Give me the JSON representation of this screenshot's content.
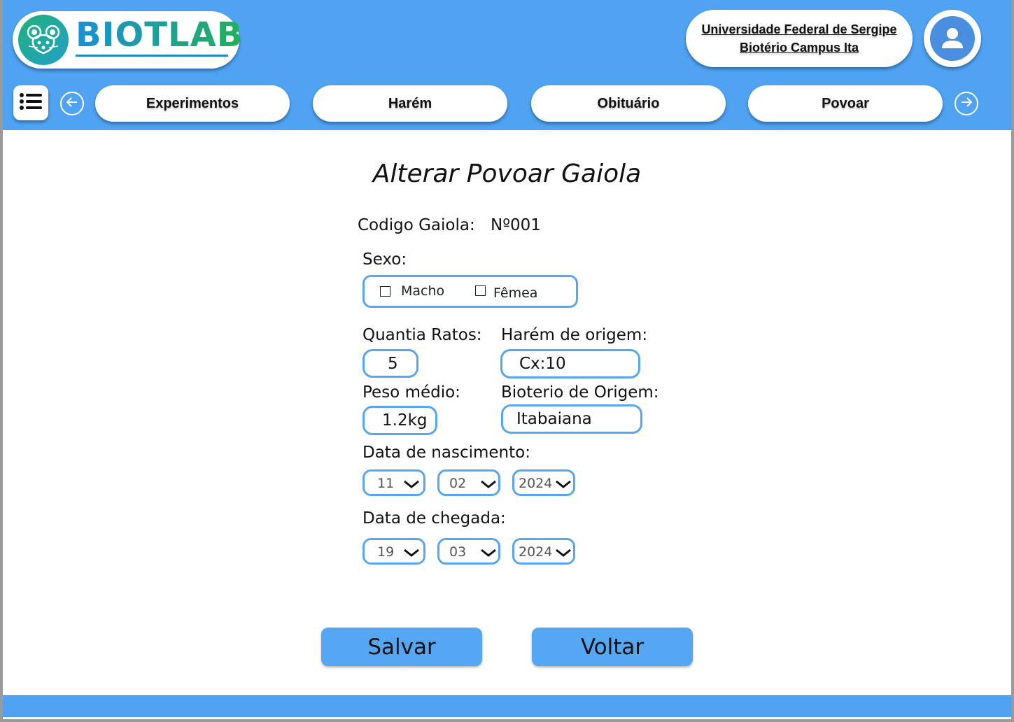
{
  "header": {
    "brand": "BIOTLAB",
    "university_line1": "Universidade Federal de Sergipe",
    "university_line2": "Biotério Campus Ita",
    "nav_tabs": [
      "Experimentos",
      "Harém",
      "Obituário",
      "Povoar"
    ]
  },
  "icons": {
    "logo": "mouse-icon",
    "menu": "list-menu-icon",
    "prev": "arrow-left-icon",
    "next": "arrow-right-icon",
    "avatar": "user-icon",
    "dropdown": "chevron-down-icon"
  },
  "colors": {
    "primary": "#4fa3f2",
    "field_border": "#5aa6ec",
    "button": "#55a7f3",
    "brand_gradient_start": "#1b8fd6",
    "brand_gradient_end": "#22b05a"
  },
  "form": {
    "title": "Alterar Povoar Gaiola",
    "codigo_label": "Codigo Gaiola:",
    "codigo_value": "Nº001",
    "sexo_label": "Sexo:",
    "sexo_options": [
      "Macho",
      "Fêmea"
    ],
    "quantia_label": "Quantia Ratos:",
    "quantia_value": "5",
    "harem_label": "Harém de origem:",
    "harem_value": "Cx:10",
    "peso_label": "Peso médio:",
    "peso_value": "1.2kg",
    "bioterio_label": "Bioterio de Origem:",
    "bioterio_value": "Itabaiana",
    "nascimento_label": "Data de nascimento:",
    "nascimento_day": "11",
    "nascimento_month": "02",
    "nascimento_year": "2024",
    "chegada_label": "Data  de chegada:",
    "chegada_day": "19",
    "chegada_month": "03",
    "chegada_year": "2024"
  },
  "buttons": {
    "save": "Salvar",
    "back": "Voltar"
  }
}
